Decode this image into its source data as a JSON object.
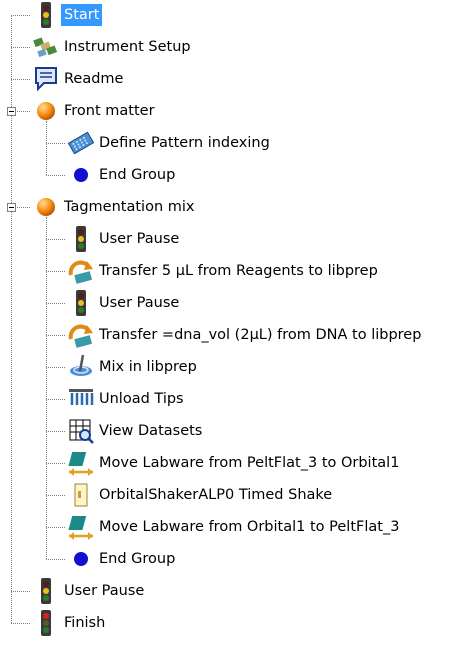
{
  "items": [
    {
      "label": "Start",
      "icon": "traffic-light-icon",
      "selected": true
    },
    {
      "label": "Instrument Setup",
      "icon": "instrument-setup-icon"
    },
    {
      "label": "Readme",
      "icon": "readme-icon"
    },
    {
      "label": "Front matter",
      "icon": "group-orb-icon"
    },
    {
      "label": "Define Pattern indexing",
      "icon": "define-pattern-icon"
    },
    {
      "label": "End Group",
      "icon": "end-group-icon"
    },
    {
      "label": "Tagmentation mix",
      "icon": "group-orb-icon"
    },
    {
      "label": "User Pause",
      "icon": "traffic-light-icon"
    },
    {
      "label": "Transfer 5 µL from Reagents to libprep",
      "icon": "transfer-icon"
    },
    {
      "label": "User Pause",
      "icon": "traffic-light-icon"
    },
    {
      "label": "Transfer =dna_vol (2µL) from DNA to libprep",
      "icon": "transfer-icon"
    },
    {
      "label": "Mix in libprep",
      "icon": "mix-icon"
    },
    {
      "label": "Unload Tips",
      "icon": "unload-tips-icon"
    },
    {
      "label": "View Datasets",
      "icon": "view-datasets-icon"
    },
    {
      "label": "Move Labware from PeltFlat_3 to Orbital1",
      "icon": "move-labware-icon"
    },
    {
      "label": "OrbitalShakerALP0 Timed Shake",
      "icon": "timed-shake-icon"
    },
    {
      "label": "Move Labware from Orbital1 to PeltFlat_3",
      "icon": "move-labware-icon"
    },
    {
      "label": "End Group",
      "icon": "end-group-icon"
    },
    {
      "label": "User Pause",
      "icon": "traffic-light-icon"
    },
    {
      "label": "Finish",
      "icon": "traffic-light-red-icon"
    }
  ]
}
